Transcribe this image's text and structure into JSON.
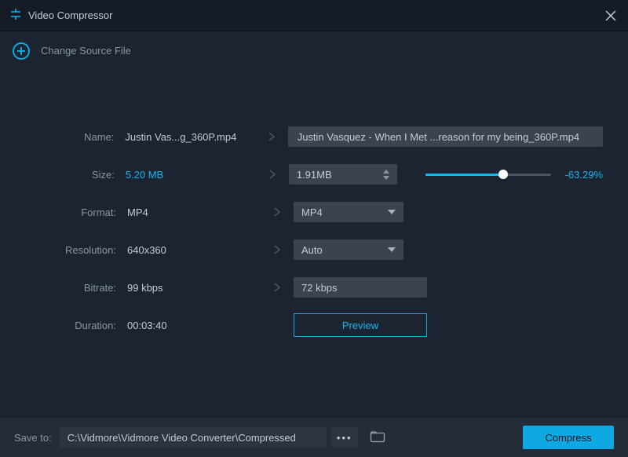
{
  "window": {
    "title": "Video Compressor"
  },
  "actions": {
    "change_source": "Change Source File"
  },
  "labels": {
    "name": "Name:",
    "size": "Size:",
    "format": "Format:",
    "resolution": "Resolution:",
    "bitrate": "Bitrate:",
    "duration": "Duration:",
    "save_to": "Save to:"
  },
  "current": {
    "name": "Justin Vas...g_360P.mp4",
    "size": "5.20 MB",
    "format": "MP4",
    "resolution": "640x360",
    "bitrate": "99 kbps",
    "duration": "00:03:40"
  },
  "target": {
    "name": "Justin Vasquez - When I Met ...reason for my being_360P.mp4",
    "size": "1.91MB",
    "format": "MP4",
    "resolution": "Auto",
    "bitrate": "72 kbps"
  },
  "slider": {
    "percent_fill": 62,
    "reduction_text": "-63.29%"
  },
  "buttons": {
    "preview": "Preview",
    "compress": "Compress",
    "more": "•••"
  },
  "output": {
    "path": "C:\\Vidmore\\Vidmore Video Converter\\Compressed"
  }
}
